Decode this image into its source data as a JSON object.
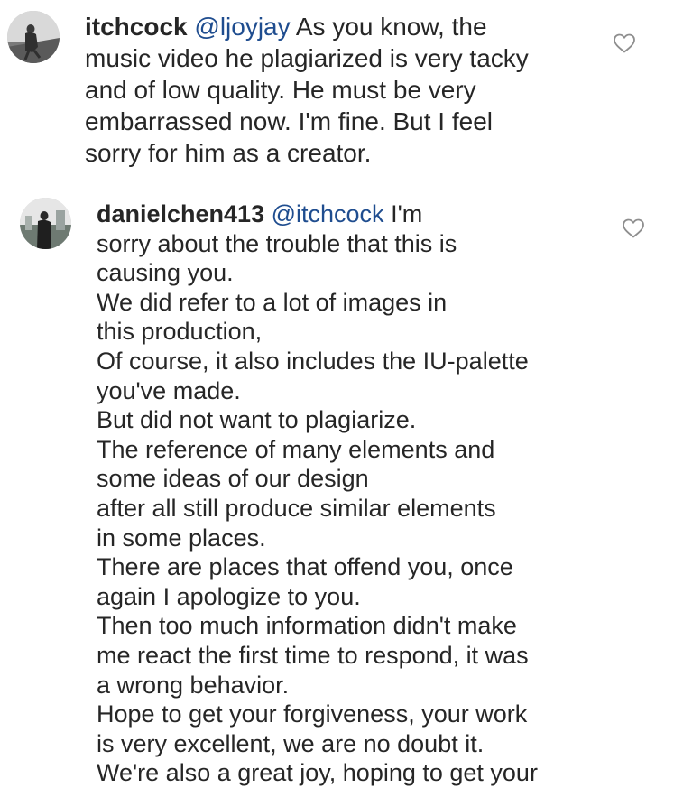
{
  "comments": [
    {
      "username": "itchcock",
      "mention": "@ljoyjay",
      "lines": [
        "As you know, the",
        "music video he plagiarized is very tacky",
        "and of low quality. He must be very",
        "embarrassed now. I'm fine. But I feel",
        "sorry for him as a creator."
      ],
      "like_icon": "heart-outline-icon"
    },
    {
      "username": "danielchen413",
      "mention": "@itchcock",
      "lines": [
        "I'm",
        "sorry about the trouble that this is",
        "causing you.",
        "We did refer to a lot of images in",
        "this production,",
        "Of course, it also includes the IU-palette",
        "you've made.",
        "But did not want to plagiarize.",
        "The reference of many elements and",
        "some ideas of our design",
        "after all still produce similar elements",
        "in some places.",
        "There are places that offend you, once",
        "again I apologize to you.",
        "Then too much information didn't make",
        "me react the first time to respond, it was",
        "a wrong behavior.",
        "Hope to get your forgiveness, your work",
        "is very excellent, we are no doubt it.",
        "We're also a great joy, hoping to get your"
      ],
      "like_icon": "heart-outline-icon"
    }
  ],
  "colors": {
    "text": "#262626",
    "mention": "#1f4d8f",
    "heart_stroke": "#8e8e8e",
    "background": "#ffffff"
  }
}
